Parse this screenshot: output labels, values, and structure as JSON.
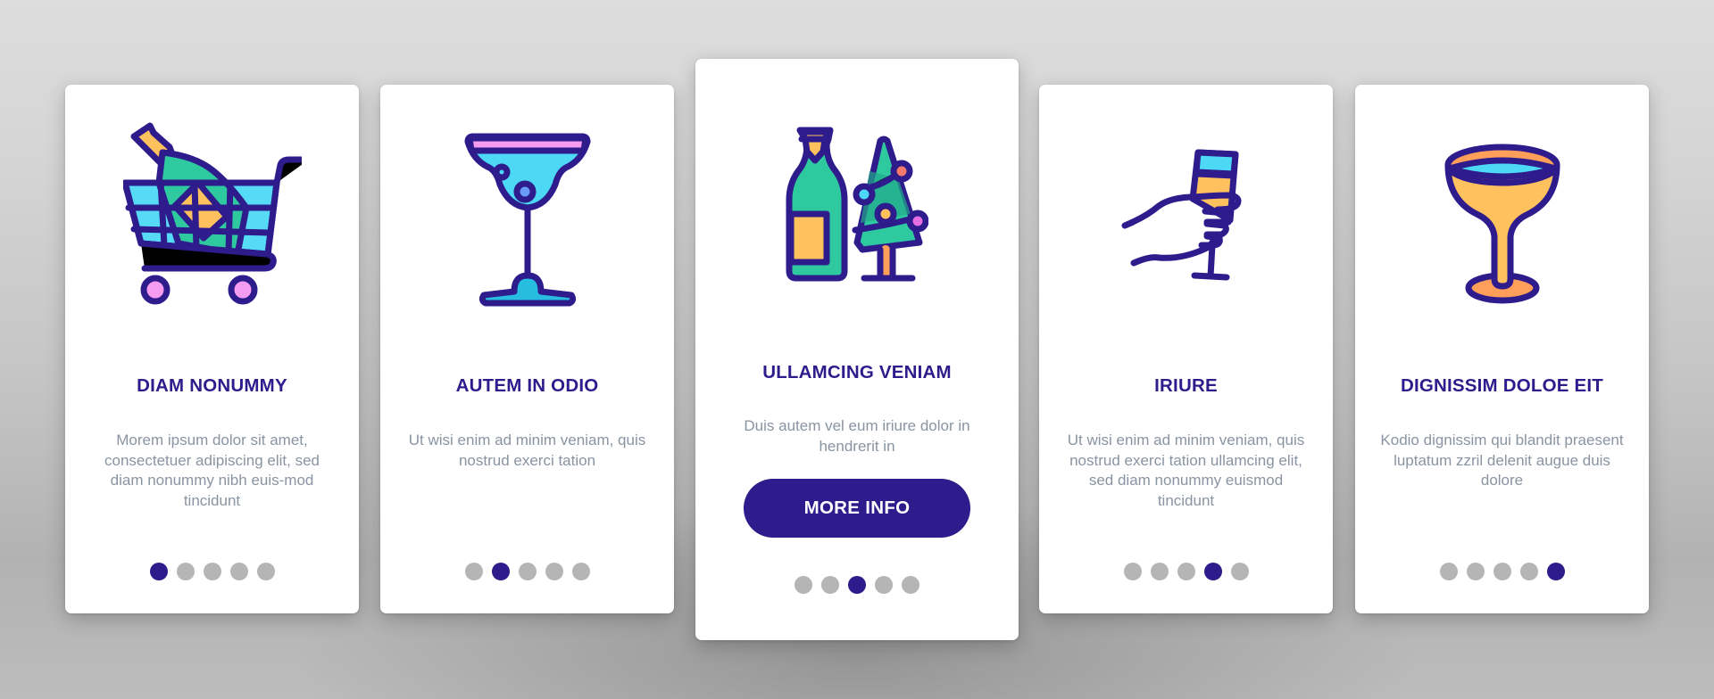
{
  "colors": {
    "primary": "#2e1b8c",
    "body_text": "#8a94a2",
    "dot_inactive": "#b5b5b5",
    "card_bg": "#ffffff"
  },
  "cards": [
    {
      "illustration": "shopping-cart-with-champagne-icon",
      "title": "DIAM NONUMMY",
      "body": "Morem ipsum dolor sit amet, consectetuer adipiscing elit, sed diam nonummy nibh euis-mod tincidunt",
      "active_page": 1
    },
    {
      "illustration": "margarita-glass-icon",
      "title": "AUTEM IN ODIO",
      "body": "Ut wisi enim ad minim veniam, quis nostrud exerci tation",
      "active_page": 2
    },
    {
      "illustration": "champagne-bottle-christmas-tree-icon",
      "title": "ULLAMCING VENIAM",
      "body": "Duis autem vel eum iriure dolor in hendrerit in",
      "button_label": "MORE INFO",
      "active_page": 3
    },
    {
      "illustration": "hand-holding-glass-icon",
      "title": "IRIURE",
      "body": "Ut wisi enim ad minim veniam, quis nostrud exerci tation ullamcing elit, sed diam nonummy euismod tincidunt",
      "active_page": 4
    },
    {
      "illustration": "coupe-glass-icon",
      "title": "DIGNISSIM DOLOE EIT",
      "body": "Kodio dignissim qui blandit praesent luptatum zzril delenit augue duis dolore",
      "active_page": 5
    }
  ],
  "pagination": {
    "total_pages": 5
  }
}
